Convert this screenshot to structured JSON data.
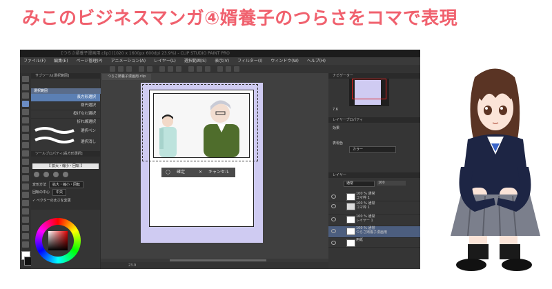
{
  "headline": "みこのビジネスマンガ④婿養子のつらさをコマで表現",
  "app": {
    "title": "[つらさ婿養子漫画用.clip] (1020 x 1600px 600dpi 23.9%) - CLIP STUDIO PAINT PRO",
    "menu": [
      "ファイル(F)",
      "編集(E)",
      "ページ管理(P)",
      "アニメーション(A)",
      "レイヤー(L)",
      "選択範囲(S)",
      "表示(V)",
      "フィルター(I)",
      "ウィンドウ(W)",
      "ヘルプ(H)"
    ],
    "subtool_panel": {
      "header": "サブツール[選択範囲]",
      "tab": "選択範囲",
      "items": [
        "長方形選択",
        "楕円選択",
        "投げなわ選択",
        "折れ線選択",
        "選択ペン",
        "選択消し"
      ]
    },
    "tool_property": {
      "header": "ツールプロパティ[長方形選択]",
      "selected": "【 拡大・縮小・回転 】",
      "rows": [
        {
          "label": "変形方法",
          "value": "拡大・縮小・回転"
        },
        {
          "label": "回転の中心",
          "value": "中央"
        },
        {
          "label": "✓ ペクターの太さを変更",
          "value": ""
        }
      ]
    },
    "document_tab": "つらさ婿養子漫画用.clip",
    "transform_bar": {
      "confirm": "確定",
      "cancel": "キャンセル"
    },
    "status_zoom": "23.9",
    "navigator_header": "ナビゲーター",
    "navigator_zoom": "7.6",
    "layer_property_header": "レイヤープロパティ",
    "effect_label": "効果",
    "expression_color_label": "表現色",
    "expression_color_value": "カラー",
    "layer_header": "レイヤー",
    "blend_mode": "通常",
    "opacity": "100",
    "layers": [
      {
        "name": "100 % 通常\nコマ枠 1",
        "selected": false
      },
      {
        "name": "100 % 通常\nコマ枠 1",
        "selected": false
      },
      {
        "name": "100 % 通常\nレイヤー 1",
        "selected": false
      },
      {
        "name": "100 % 通常\nつらさ婿養子漫画用",
        "selected": true
      },
      {
        "name": "用紙",
        "selected": false
      }
    ]
  },
  "colors": {
    "headline": "#f0616e",
    "paper_lavender": "#cfcbf2",
    "selection_blue": "#5b7fb3",
    "uniform_green": "#4f6d2c"
  }
}
